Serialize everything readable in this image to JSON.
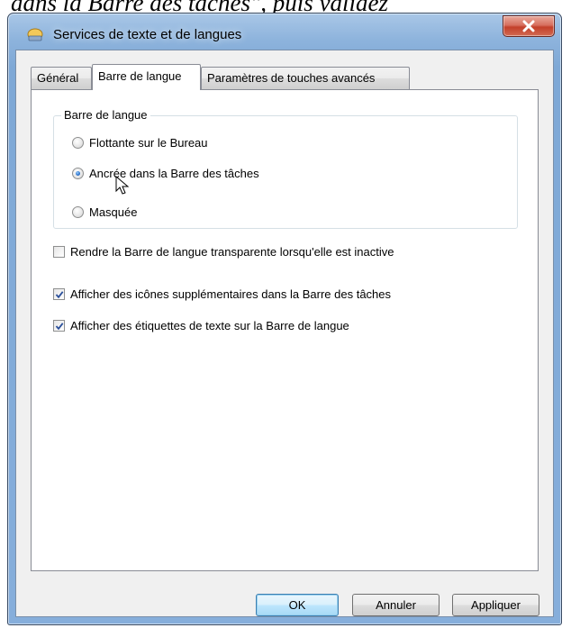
{
  "doc_caption": "dans la Barre des tâches\", puis validez",
  "window": {
    "title": "Services de texte et de langues",
    "close_icon": "close-icon"
  },
  "tabs": [
    {
      "label": "Général",
      "active": false
    },
    {
      "label": "Barre de langue",
      "active": true
    },
    {
      "label": "Paramètres de touches avancés",
      "active": false
    }
  ],
  "group": {
    "title": "Barre de langue",
    "options": [
      {
        "label": "Flottante sur le Bureau",
        "selected": false
      },
      {
        "label": "Ancrée dans la Barre des tâches",
        "selected": true
      },
      {
        "label": "Masquée",
        "selected": false
      }
    ]
  },
  "checkboxes": [
    {
      "label": "Rendre la Barre de langue transparente lorsqu'elle est inactive",
      "checked": false
    },
    {
      "label": "Afficher des icônes supplémentaires dans la Barre des tâches",
      "checked": true
    },
    {
      "label": "Afficher des étiquettes de texte sur la Barre de langue",
      "checked": true
    }
  ],
  "buttons": {
    "ok": "OK",
    "cancel": "Annuler",
    "apply": "Appliquer"
  },
  "colors": {
    "titlebar": "#8db3dc",
    "close_button": "#c3402b",
    "default_button_border": "#3c7fb1",
    "radio_dot": "#2a6fc9"
  }
}
